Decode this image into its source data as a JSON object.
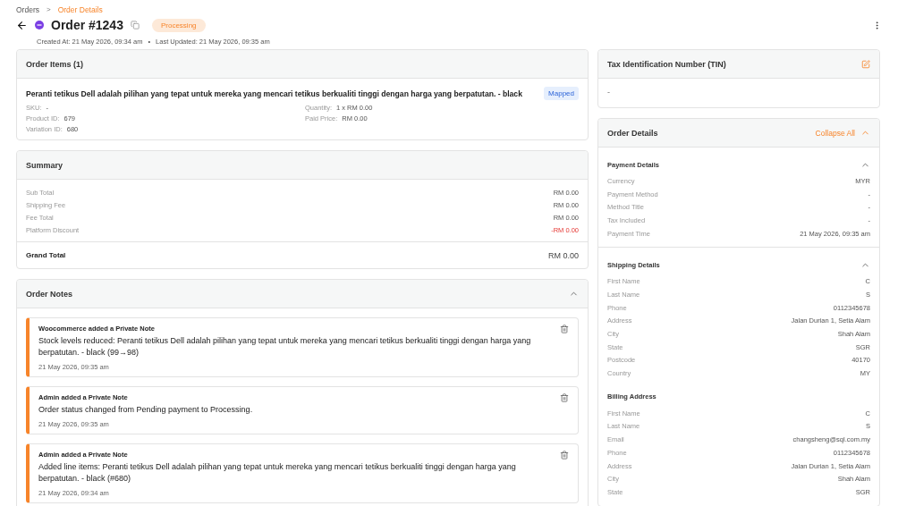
{
  "breadcrumb": [
    {
      "label": "Orders",
      "current": false
    },
    {
      "label": "Order Details",
      "current": true
    }
  ],
  "breadcrumb_separator": ">",
  "header": {
    "title": "Order #1243",
    "status": "Processing",
    "created": "Created At: 21 May 2026, 09:34 am",
    "separator": "•",
    "updated": "Last Updated: 21 May 2026, 09:35 am"
  },
  "order_items": {
    "title": "Order Items (1)",
    "items": [
      {
        "name": "Peranti tetikus Dell adalah pilihan yang tepat untuk mereka yang mencari tetikus berkualiti tinggi dengan harga yang berpatutan. - black",
        "badge": "Mapped",
        "left": [
          {
            "label": "SKU:",
            "value": "-"
          },
          {
            "label": "Product ID:",
            "value": "679"
          },
          {
            "label": "Variation ID:",
            "value": "680"
          }
        ],
        "right": [
          {
            "label": "Quantity:",
            "value": "1 x RM 0.00"
          },
          {
            "label": "Paid Price:",
            "value": "RM 0.00"
          }
        ]
      }
    ]
  },
  "summary": {
    "title": "Summary",
    "rows": [
      {
        "label": "Sub Total",
        "value": "RM 0.00",
        "kind": "normal"
      },
      {
        "label": "Shipping Fee",
        "value": "RM 0.00",
        "kind": "normal"
      },
      {
        "label": "Fee Total",
        "value": "RM 0.00",
        "kind": "normal"
      },
      {
        "label": "Platform Discount",
        "value": "-RM 0.00",
        "kind": "discount"
      }
    ],
    "total": {
      "label": "Grand Total",
      "value": "RM 0.00"
    }
  },
  "order_notes": {
    "title": "Order Notes",
    "expanded": true,
    "notes": [
      {
        "author": "Woocommerce added a Private Note",
        "text": "Stock levels reduced: Peranti tetikus Dell adalah pilihan yang tepat untuk mereka yang mencari tetikus berkualiti tinggi dengan harga yang berpatutan. - black (99→98)",
        "time": "21 May 2026, 09:35 am"
      },
      {
        "author": "Admin added a Private Note",
        "text": "Order status changed from Pending payment to Processing.",
        "time": "21 May 2026, 09:35 am"
      },
      {
        "author": "Admin added a Private Note",
        "text": "Added line items: Peranti tetikus Dell adalah pilihan yang tepat untuk mereka yang mencari tetikus berkualiti tinggi dengan harga yang berpatutan. - black (#680)",
        "time": "21 May 2026, 09:34 am"
      }
    ]
  },
  "tin": {
    "title": "Tax Identification Number (TIN)",
    "value": "-"
  },
  "order_details": {
    "title": "Order Details",
    "action": "Collapse All",
    "sections": [
      {
        "title": "Payment Details",
        "expanded": true,
        "rows": [
          {
            "label": "Currency",
            "value": "MYR"
          },
          {
            "label": "Payment Method",
            "value": "-"
          },
          {
            "label": "Method Title",
            "value": "-"
          },
          {
            "label": "Tax Included",
            "value": "-"
          },
          {
            "label": "Payment Time",
            "value": "21 May 2026, 09:35 am"
          }
        ]
      },
      {
        "title": "Shipping Details",
        "expanded": true,
        "rows": [
          {
            "label": "First Name",
            "value": "C"
          },
          {
            "label": "Last Name",
            "value": "S"
          },
          {
            "label": "Phone",
            "value": "0112345678"
          },
          {
            "label": "Address",
            "value": "Jalan Durian 1, Setia Alam"
          },
          {
            "label": "City",
            "value": "Shah Alam"
          },
          {
            "label": "State",
            "value": "SGR"
          },
          {
            "label": "Postcode",
            "value": "40170"
          },
          {
            "label": "Country",
            "value": "MY"
          }
        ]
      },
      {
        "title": "Billing Address",
        "rows": [
          {
            "label": "First Name",
            "value": "C"
          },
          {
            "label": "Last Name",
            "value": "S"
          },
          {
            "label": "Email",
            "value": "changsheng@sql.com.my"
          },
          {
            "label": "Phone",
            "value": "0112345678"
          },
          {
            "label": "Address",
            "value": "Jalan Durian 1, Setia Alam"
          },
          {
            "label": "City",
            "value": "Shah Alam"
          },
          {
            "label": "State",
            "value": "SGR"
          }
        ]
      }
    ]
  }
}
